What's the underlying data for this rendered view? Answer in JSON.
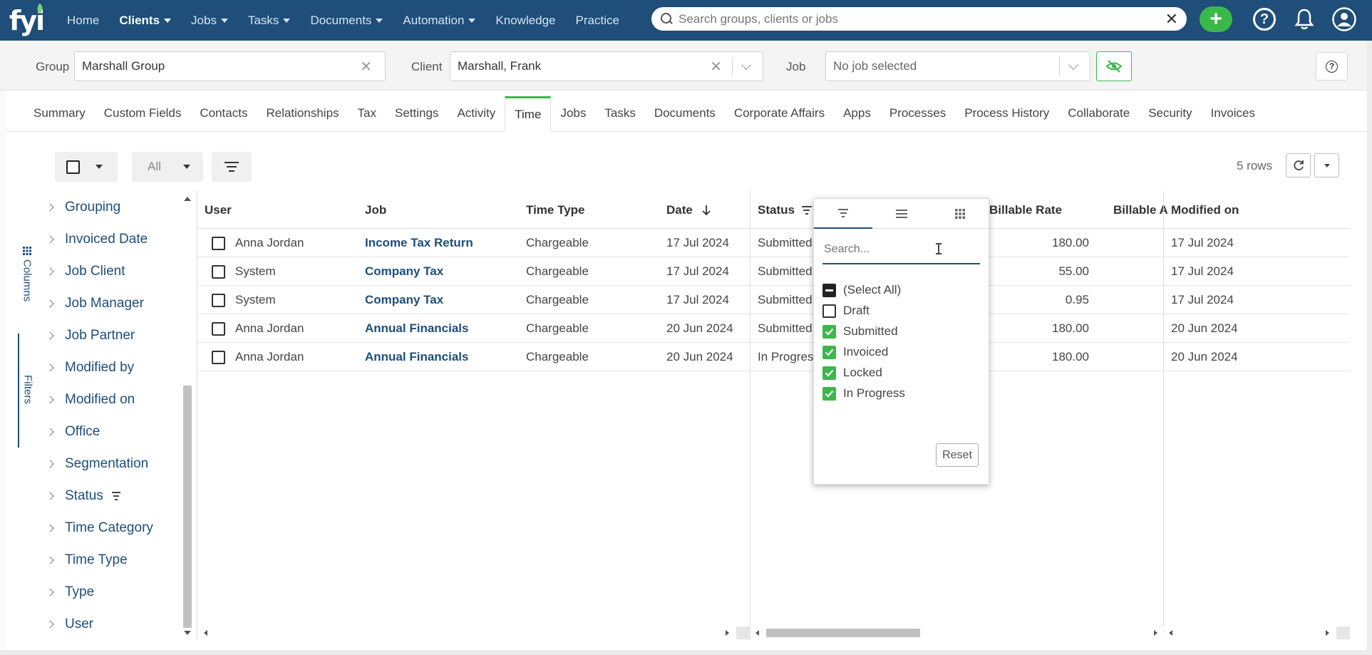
{
  "nav": {
    "logo": "fyi",
    "items": [
      {
        "label": "Home",
        "dropdown": false,
        "active": false
      },
      {
        "label": "Clients",
        "dropdown": true,
        "active": true
      },
      {
        "label": "Jobs",
        "dropdown": true,
        "active": false
      },
      {
        "label": "Tasks",
        "dropdown": true,
        "active": false
      },
      {
        "label": "Documents",
        "dropdown": true,
        "active": false
      },
      {
        "label": "Automation",
        "dropdown": true,
        "active": false
      },
      {
        "label": "Knowledge",
        "dropdown": false,
        "active": false
      },
      {
        "label": "Practice",
        "dropdown": false,
        "active": false
      }
    ],
    "search_placeholder": "Search groups, clients or jobs",
    "add_label": "+",
    "help_label": "?"
  },
  "context": {
    "group_label": "Group",
    "group_value": "Marshall Group",
    "client_label": "Client",
    "client_value": "Marshall, Frank",
    "job_label": "Job",
    "job_value": "No job selected",
    "help_label": "?"
  },
  "tabs": [
    "Summary",
    "Custom Fields",
    "Contacts",
    "Relationships",
    "Tax",
    "Settings",
    "Activity",
    "Time",
    "Jobs",
    "Tasks",
    "Documents",
    "Corporate Affairs",
    "Apps",
    "Processes",
    "Process History",
    "Collaborate",
    "Security",
    "Invoices"
  ],
  "active_tab": "Time",
  "toolbar": {
    "all_label": "All",
    "row_count": "5 rows"
  },
  "side_panel": {
    "tab_columns": "Columns",
    "tab_filters": "Filters",
    "items": [
      "Grouping",
      "Invoiced Date",
      "Job Client",
      "Job Manager",
      "Job Partner",
      "Modified by",
      "Modified on",
      "Office",
      "Segmentation",
      "Status",
      "Time Category",
      "Time Type",
      "Type",
      "User"
    ],
    "filtered_item": "Status"
  },
  "grid": {
    "headers": {
      "user": "User",
      "job": "Job",
      "time_type": "Time Type",
      "date": "Date",
      "status": "Status",
      "billable_rate": "Billable Rate",
      "billable_amount": "Billable A",
      "modified_on": "Modified on"
    },
    "rows": [
      {
        "user": "Anna Jordan",
        "job": "Income Tax Return",
        "time_type": "Chargeable",
        "date": "17 Jul 2024",
        "status": "Submitted",
        "billable_rate": "180.00",
        "modified_on": "17 Jul 2024"
      },
      {
        "user": "System",
        "job": "Company Tax",
        "time_type": "Chargeable",
        "date": "17 Jul 2024",
        "status": "Submitted",
        "billable_rate": "55.00",
        "modified_on": "17 Jul 2024"
      },
      {
        "user": "System",
        "job": "Company Tax",
        "time_type": "Chargeable",
        "date": "17 Jul 2024",
        "status": "Submitted",
        "billable_rate": "0.95",
        "modified_on": "17 Jul 2024"
      },
      {
        "user": "Anna Jordan",
        "job": "Annual Financials",
        "time_type": "Chargeable",
        "date": "20 Jun 2024",
        "status": "Submitted",
        "billable_rate": "180.00",
        "modified_on": "20 Jun 2024"
      },
      {
        "user": "Anna Jordan",
        "job": "Annual Financials",
        "time_type": "Chargeable",
        "date": "20 Jun 2024",
        "status": "In Progres",
        "billable_rate": "180.00",
        "modified_on": "20 Jun 2024"
      }
    ]
  },
  "status_filter": {
    "search_placeholder": "Search...",
    "options": [
      {
        "label": "(Select All)",
        "state": "partial"
      },
      {
        "label": "Draft",
        "state": "unchecked"
      },
      {
        "label": "Submitted",
        "state": "checked"
      },
      {
        "label": "Invoiced",
        "state": "checked"
      },
      {
        "label": "Locked",
        "state": "checked"
      },
      {
        "label": "In Progress",
        "state": "checked"
      }
    ],
    "reset_label": "Reset"
  },
  "colors": {
    "nav_bg": "#1e4e79",
    "accent_green": "#3bb84a",
    "link_blue": "#1e4e79"
  }
}
